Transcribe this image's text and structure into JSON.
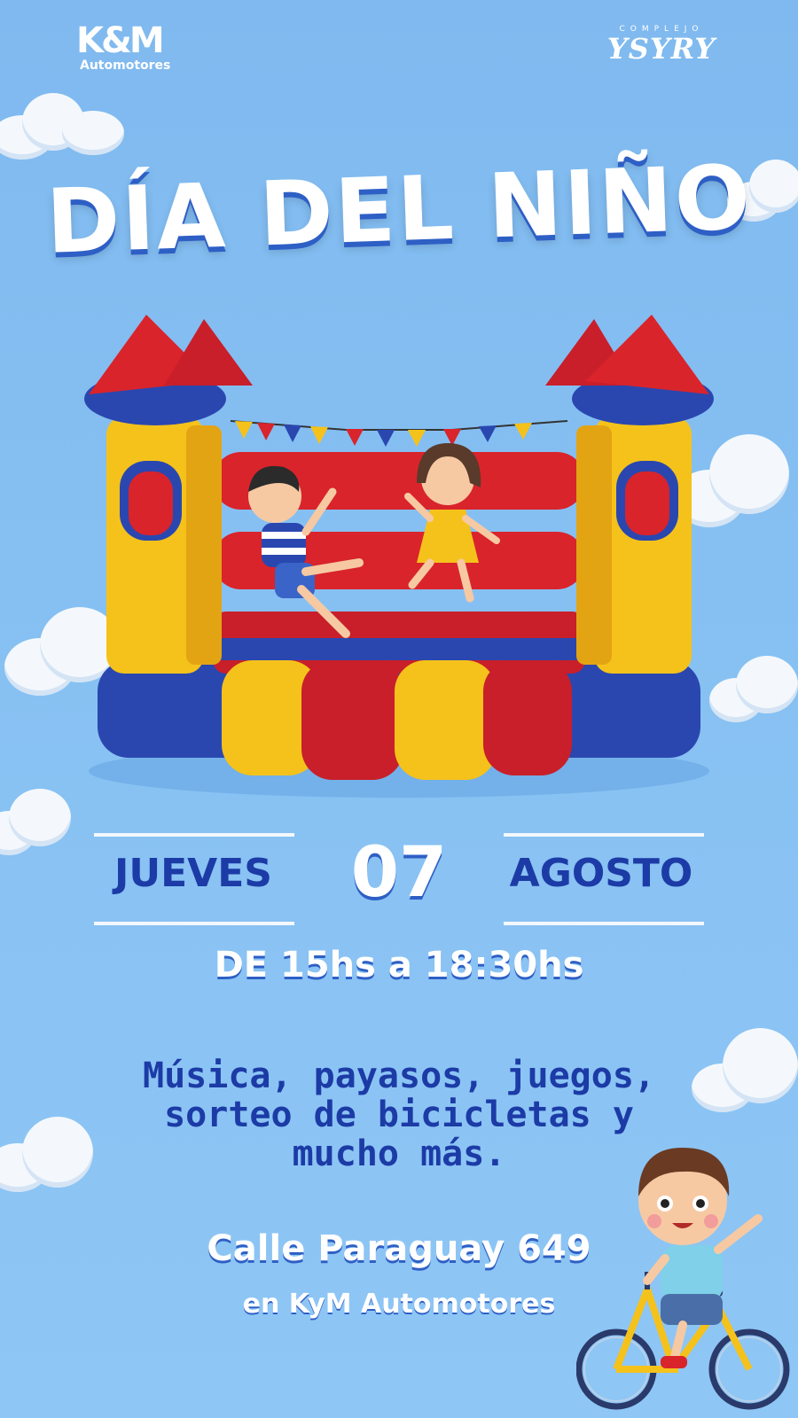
{
  "logos": {
    "km_mark": "K&M",
    "km_text": "Automotores",
    "ysyry_sub": "COMPLEJO",
    "ysyry_main": "YSYRY"
  },
  "title": "DÍA DEL NIÑO",
  "date": {
    "weekday": "JUEVES",
    "day": "07",
    "month": "AGOSTO"
  },
  "time": "DE 15hs a 18:30hs",
  "activities": [
    "Música, payasos, juegos,",
    "sorteo de bicicletas y",
    "mucho más."
  ],
  "address": "Calle Paraguay 649",
  "venue": "en KyM Automotores",
  "colors": {
    "background": "#86c0f2",
    "accent_blue": "#1c3ba6",
    "castle_red": "#d9242b",
    "castle_yellow": "#f5c21b",
    "castle_blue": "#2a47b0"
  },
  "illustrations": [
    "bouncy-castle-with-two-kids",
    "boy-on-bicycle",
    "clouds"
  ]
}
